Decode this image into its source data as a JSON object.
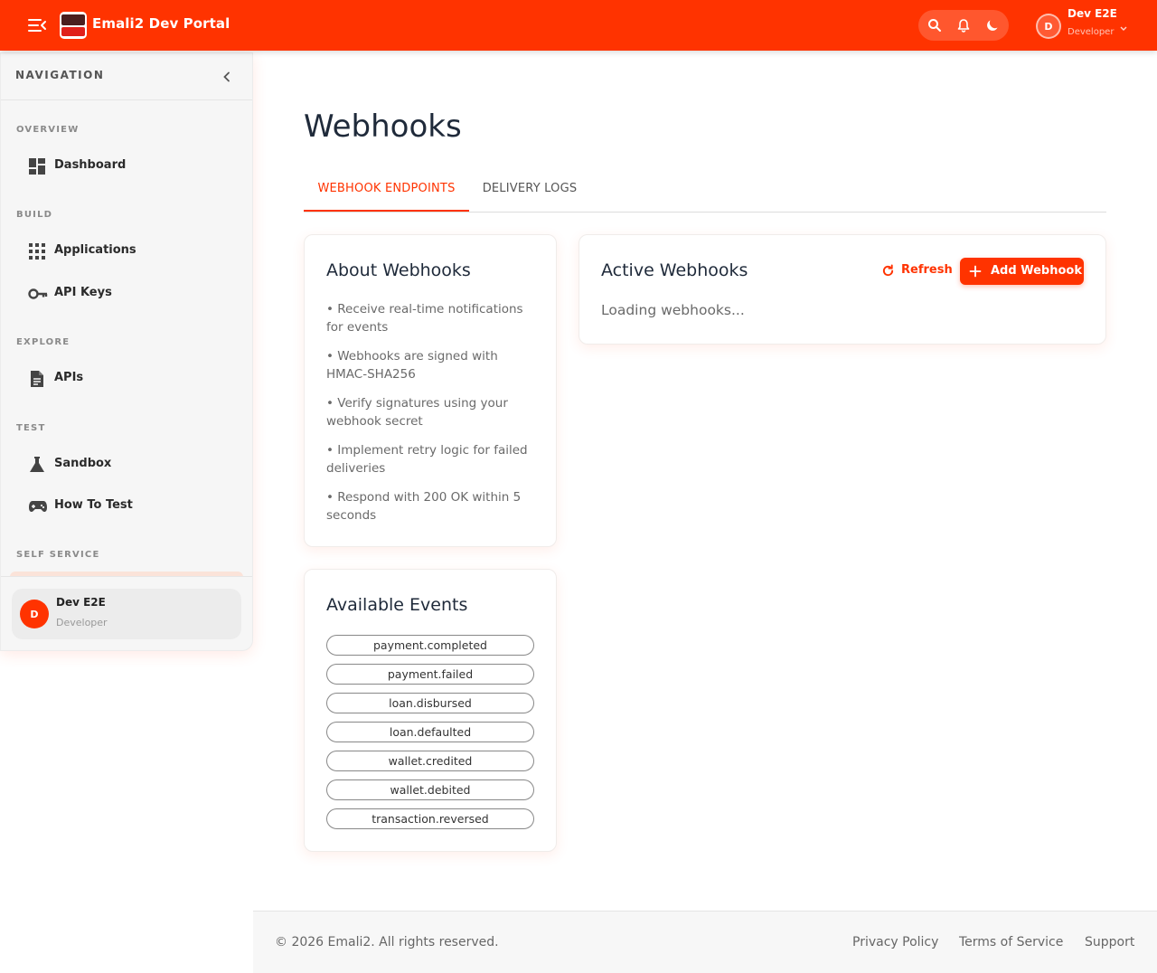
{
  "header": {
    "brand": "Emali2 Dev Portal",
    "user_name": "Dev E2E",
    "user_role": "Developer",
    "avatar_initial": "D",
    "accent": "#ff3300"
  },
  "icons": {
    "menu": "menu-open-icon",
    "search": "search-icon",
    "notifications": "bell-icon",
    "theme": "moon-icon",
    "chevron": "chevron-down-icon"
  },
  "sidebar": {
    "title": "NAVIGATION",
    "sections": [
      {
        "label": "OVERVIEW",
        "items": [
          {
            "label": "Dashboard",
            "icon": "dashboard-icon"
          }
        ]
      },
      {
        "label": "BUILD",
        "items": [
          {
            "label": "Applications",
            "icon": "apps-grid-icon"
          },
          {
            "label": "API Keys",
            "icon": "key-icon"
          }
        ]
      },
      {
        "label": "EXPLORE",
        "items": [
          {
            "label": "APIs",
            "icon": "document-icon"
          }
        ]
      },
      {
        "label": "TEST",
        "items": [
          {
            "label": "Sandbox",
            "icon": "flask-icon"
          },
          {
            "label": "How To Test",
            "icon": "gamepad-icon"
          }
        ]
      },
      {
        "label": "SELF SERVICE",
        "items": []
      }
    ],
    "user": {
      "name": "Dev E2E",
      "role": "Developer",
      "initial": "D"
    }
  },
  "main": {
    "title": "Webhooks",
    "tabs": [
      {
        "label": "WEBHOOK ENDPOINTS",
        "active": true
      },
      {
        "label": "DELIVERY LOGS",
        "active": false
      }
    ],
    "about": {
      "title": "About Webhooks",
      "points": [
        "• Receive real-time notifications for events",
        "• Webhooks are signed with HMAC-SHA256",
        "• Verify signatures using your webhook secret",
        "• Implement retry logic for failed deliveries",
        "• Respond with 200 OK within 5 seconds"
      ]
    },
    "events": {
      "title": "Available Events",
      "items": [
        "payment.completed",
        "payment.failed",
        "loan.disbursed",
        "loan.defaulted",
        "wallet.credited",
        "wallet.debited",
        "transaction.reversed"
      ]
    },
    "active": {
      "title": "Active Webhooks",
      "refresh_label": "Refresh",
      "add_label": "Add Webhook",
      "loading_text": "Loading webhooks..."
    }
  },
  "footer": {
    "copyright": "© 2026 Emali2. All rights reserved.",
    "links": [
      "Privacy Policy",
      "Terms of Service",
      "Support"
    ]
  }
}
